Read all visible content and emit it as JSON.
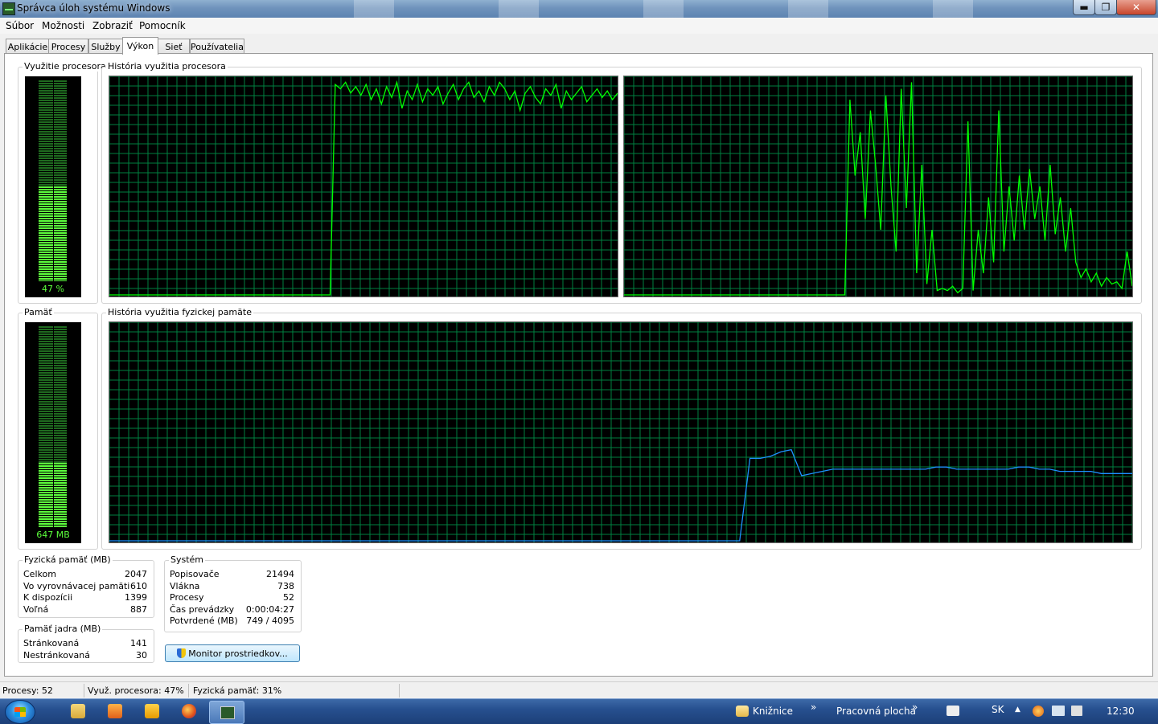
{
  "window": {
    "title": "Správca úloh systému Windows"
  },
  "titlebar_buttons": {
    "minimize": "▬",
    "maximize": "❐",
    "close": "✕"
  },
  "menu": [
    "Súbor",
    "Možnosti",
    "Zobraziť",
    "Pomocník"
  ],
  "tabs": [
    {
      "label": "Aplikácie",
      "active": false
    },
    {
      "label": "Procesy",
      "active": false
    },
    {
      "label": "Služby",
      "active": false
    },
    {
      "label": "Výkon",
      "active": true
    },
    {
      "label": "Sieť",
      "active": false
    },
    {
      "label": "Používatelia",
      "active": false
    }
  ],
  "cpu": {
    "meter_title": "Využitie procesora",
    "meter_label": "47 %",
    "meter_fraction": 0.47,
    "history_title": "História využitia procesora"
  },
  "memory": {
    "meter_title": "Pamäť",
    "meter_label": "647 MB",
    "meter_fraction": 0.32,
    "history_title": "História využitia fyzickej pamäte"
  },
  "physical_memory": {
    "title": "Fyzická pamäť (MB)",
    "rows": [
      {
        "label": "Celkom",
        "value": "2047"
      },
      {
        "label": "Vo vyrovnávacej pamäti",
        "value": "610"
      },
      {
        "label": "K dispozícii",
        "value": "1399"
      },
      {
        "label": "Voľná",
        "value": "887"
      }
    ]
  },
  "kernel_memory": {
    "title": "Pamäť jadra (MB)",
    "rows": [
      {
        "label": "Stránkovaná",
        "value": "141"
      },
      {
        "label": "Nestránkovaná",
        "value": "30"
      }
    ]
  },
  "system": {
    "title": "Systém",
    "rows": [
      {
        "label": "Popisovače",
        "value": "21494"
      },
      {
        "label": "Vlákna",
        "value": "738"
      },
      {
        "label": "Procesy",
        "value": "52"
      },
      {
        "label": "Čas prevádzky",
        "value": "0:00:04:27"
      },
      {
        "label": "Potvrdené (MB)",
        "value": "749 / 4095"
      }
    ]
  },
  "resource_monitor_button": "Monitor prostriedkov...",
  "statusbar": {
    "processes": "Procesy: 52",
    "cpu_usage": "Využ. procesora: 47%",
    "physical_memory": "Fyzická pamäť: 31%"
  },
  "taskbar": {
    "libraries": "Knižnice",
    "libraries_chevron": "»",
    "desktop": "Pracovná plocha",
    "desktop_chevron": "»",
    "language": "SK",
    "tray_arrow": "▲",
    "clock": "12:30"
  },
  "colors": {
    "graph_grid": "#008040",
    "cpu_line": "#00ff00",
    "memory_line": "#1e90ff",
    "meter_fill": "#5cff3c"
  },
  "chart_data": [
    {
      "type": "line",
      "name": "cpu-core-1",
      "ylim": [
        0,
        100
      ],
      "x_samples": 100,
      "values": [
        0,
        0,
        0,
        0,
        0,
        0,
        0,
        0,
        0,
        0,
        0,
        0,
        0,
        0,
        0,
        0,
        0,
        0,
        0,
        0,
        0,
        0,
        0,
        0,
        0,
        0,
        0,
        0,
        0,
        0,
        0,
        0,
        0,
        0,
        0,
        0,
        0,
        0,
        0,
        0,
        0,
        0,
        0,
        0,
        97,
        95,
        98,
        93,
        96,
        92,
        97,
        90,
        95,
        88,
        96,
        91,
        98,
        86,
        94,
        90,
        97,
        89,
        95,
        92,
        96,
        88,
        93,
        97,
        90,
        95,
        98,
        91,
        94,
        89,
        96,
        92,
        98,
        95,
        90,
        94,
        85,
        93,
        96,
        91,
        88,
        95,
        92,
        97,
        86,
        94,
        90,
        93,
        96,
        89,
        92,
        95,
        91,
        94,
        90,
        93
      ]
    },
    {
      "type": "line",
      "name": "cpu-core-2",
      "ylim": [
        0,
        100
      ],
      "x_samples": 100,
      "values": [
        0,
        0,
        0,
        0,
        0,
        0,
        0,
        0,
        0,
        0,
        0,
        0,
        0,
        0,
        0,
        0,
        0,
        0,
        0,
        0,
        0,
        0,
        0,
        0,
        0,
        0,
        0,
        0,
        0,
        0,
        0,
        0,
        0,
        0,
        0,
        0,
        0,
        0,
        0,
        0,
        0,
        0,
        0,
        0,
        90,
        55,
        75,
        35,
        85,
        60,
        30,
        92,
        50,
        20,
        95,
        40,
        98,
        10,
        60,
        5,
        30,
        2,
        3,
        2,
        4,
        1,
        3,
        80,
        2,
        30,
        10,
        45,
        15,
        85,
        20,
        50,
        25,
        55,
        30,
        58,
        35,
        50,
        25,
        60,
        28,
        45,
        20,
        40,
        15,
        8,
        12,
        6,
        10,
        4,
        8,
        5,
        6,
        3,
        20,
        4
      ]
    },
    {
      "type": "line",
      "name": "physical-memory",
      "ylim": [
        0,
        100
      ],
      "x_samples": 100,
      "values": [
        0,
        0,
        0,
        0,
        0,
        0,
        0,
        0,
        0,
        0,
        0,
        0,
        0,
        0,
        0,
        0,
        0,
        0,
        0,
        0,
        0,
        0,
        0,
        0,
        0,
        0,
        0,
        0,
        0,
        0,
        0,
        0,
        0,
        0,
        0,
        0,
        0,
        0,
        0,
        0,
        0,
        0,
        0,
        0,
        0,
        0,
        0,
        0,
        0,
        0,
        0,
        0,
        0,
        0,
        0,
        0,
        0,
        0,
        0,
        0,
        0,
        0,
        0,
        0,
        0,
        0,
        0,
        0,
        0,
        0,
        0,
        0,
        38,
        38,
        39,
        41,
        42,
        30,
        31,
        32,
        33,
        33,
        33,
        33,
        33,
        33,
        33,
        33,
        33,
        33,
        34,
        34,
        33,
        33,
        33,
        33,
        33,
        33,
        34,
        34,
        33,
        33,
        32,
        32,
        32,
        32,
        31,
        31,
        31,
        31
      ]
    }
  ]
}
